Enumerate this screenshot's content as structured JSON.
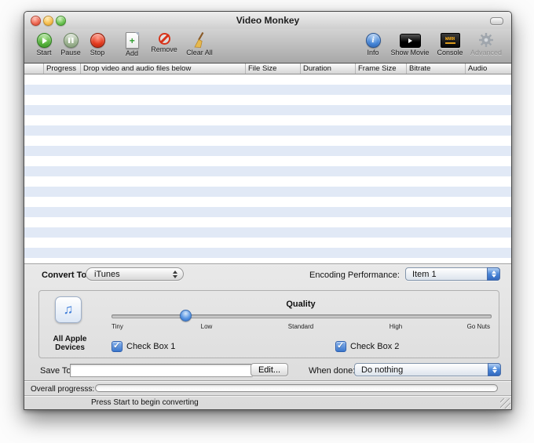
{
  "window": {
    "title": "Video Monkey"
  },
  "toolbar": {
    "start": "Start",
    "pause": "Pause",
    "stop": "Stop",
    "add": "Add",
    "remove": "Remove",
    "clear_all": "Clear All",
    "info": "Info",
    "show_movie": "Show Movie",
    "console": "Console",
    "advanced": "Advanced",
    "console_icon_text": "WARN"
  },
  "table": {
    "headers": [
      "",
      "Progress",
      "Drop video and audio files below",
      "File Size",
      "Duration",
      "Frame Size",
      "Bitrate",
      "Audio"
    ],
    "rows": []
  },
  "panel": {
    "convert_to_label": "Convert To:",
    "convert_to_value": "iTunes",
    "encoding_label": "Encoding Performance:",
    "encoding_value": "Item 1",
    "device_line1": "All Apple",
    "device_line2": "Devices",
    "quality_label": "Quality",
    "ticks": [
      "Tiny",
      "Low",
      "Standard",
      "High",
      "Go Nuts"
    ],
    "checkbox1_label": "Check Box 1",
    "checkbox1_checked": true,
    "checkbox2_label": "Check Box 2",
    "checkbox2_checked": true,
    "save_to_label": "Save To:",
    "save_to_value": "",
    "edit_button": "Edit...",
    "when_done_label": "When done:",
    "when_done_value": "Do nothing",
    "progress_label": "Overall progresss:",
    "progress_percent": 0,
    "status": "Press Start to begin converting"
  },
  "colors": {
    "accent_blue": "#3a76cc",
    "stripe_blue": "#e1e9f6",
    "start_green": "#2f8a1d",
    "stop_red": "#a81c05"
  }
}
